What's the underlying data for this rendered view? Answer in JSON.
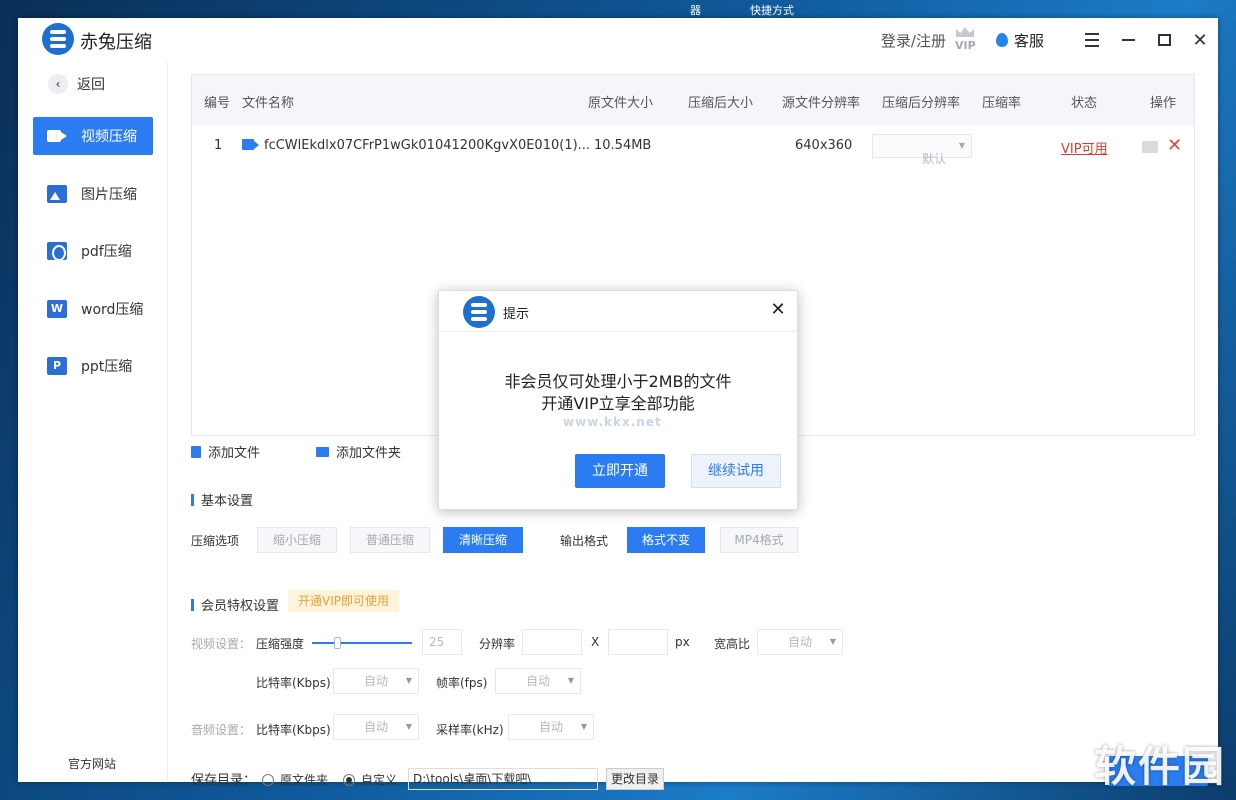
{
  "desktop": {
    "top_items": [
      "器",
      "快捷方式"
    ]
  },
  "app": {
    "name": "赤兔压缩"
  },
  "titlebar": {
    "login": "登录/注册",
    "vip_badge": "VIP",
    "service": "客服",
    "menu_icon": "menu-icon",
    "min_icon": "minimize-icon",
    "max_icon": "maximize-icon",
    "close_icon": "close-icon"
  },
  "sidebar": {
    "back": "返回",
    "items": [
      {
        "label": "视频压缩",
        "icon": "video-icon",
        "active": true
      },
      {
        "label": "图片压缩",
        "icon": "image-icon",
        "active": false
      },
      {
        "label": "pdf压缩",
        "icon": "pdf-icon",
        "active": false
      },
      {
        "label": "word压缩",
        "icon": "word-icon",
        "active": false
      },
      {
        "label": "ppt压缩",
        "icon": "ppt-icon",
        "active": false
      }
    ],
    "official_site": "官方网站"
  },
  "table": {
    "columns": [
      "编号",
      "文件名称",
      "原文件大小",
      "压缩后大小",
      "源文件分辨率",
      "压缩后分辨率",
      "压缩率",
      "状态",
      "操作"
    ],
    "rows": [
      {
        "index": "1",
        "name": "fcCWlEkdlx07CFrP1wGk01041200KgvX0E010(1)...",
        "orig_size": "10.54MB",
        "comp_size": "",
        "orig_res": "640x360",
        "comp_res": "默认",
        "ratio": "",
        "status": "VIP可用"
      }
    ]
  },
  "actions": {
    "add_file": "添加文件",
    "add_folder": "添加文件夹"
  },
  "basic": {
    "title": "基本设置",
    "compress_label": "压缩选项",
    "compress_options": [
      "缩小压缩",
      "普通压缩",
      "清晰压缩"
    ],
    "compress_selected": "清晰压缩",
    "format_label": "输出格式",
    "format_options": [
      "格式不变",
      "MP4格式"
    ],
    "format_selected": "格式不变"
  },
  "vip": {
    "title": "会员特权设置",
    "badge": "开通VIP即可使用",
    "video_label": "视频设置：",
    "strength_label": "压缩强度",
    "strength_value": "25",
    "resolution_label": "分辨率",
    "x_label": "X",
    "px_label": "px",
    "aspect_label": "宽高比",
    "aspect_value": "自动",
    "bitrate_label": "比特率(Kbps)",
    "bitrate_value": "自动",
    "fps_label": "帧率(fps)",
    "fps_value": "自动",
    "audio_label": "音频设置：",
    "audio_bitrate_label": "比特率(Kbps)",
    "audio_bitrate_value": "自动",
    "sample_label": "采样率(kHz)",
    "sample_value": "自动"
  },
  "save": {
    "label": "保存目录：",
    "opt_original": "原文件夹",
    "opt_custom": "自定义",
    "selected": "自定义",
    "path": "D:\\tools\\桌面\\下载吧\\",
    "change": "更改目录"
  },
  "dialog": {
    "title": "提示",
    "line1": "非会员仅可处理小于2MB的文件",
    "line2": "开通VIP立享全部功能",
    "watermark": "www.kkx.net",
    "primary": "立即开通",
    "secondary": "继续试用"
  },
  "watermark": {
    "text": "软件园"
  }
}
